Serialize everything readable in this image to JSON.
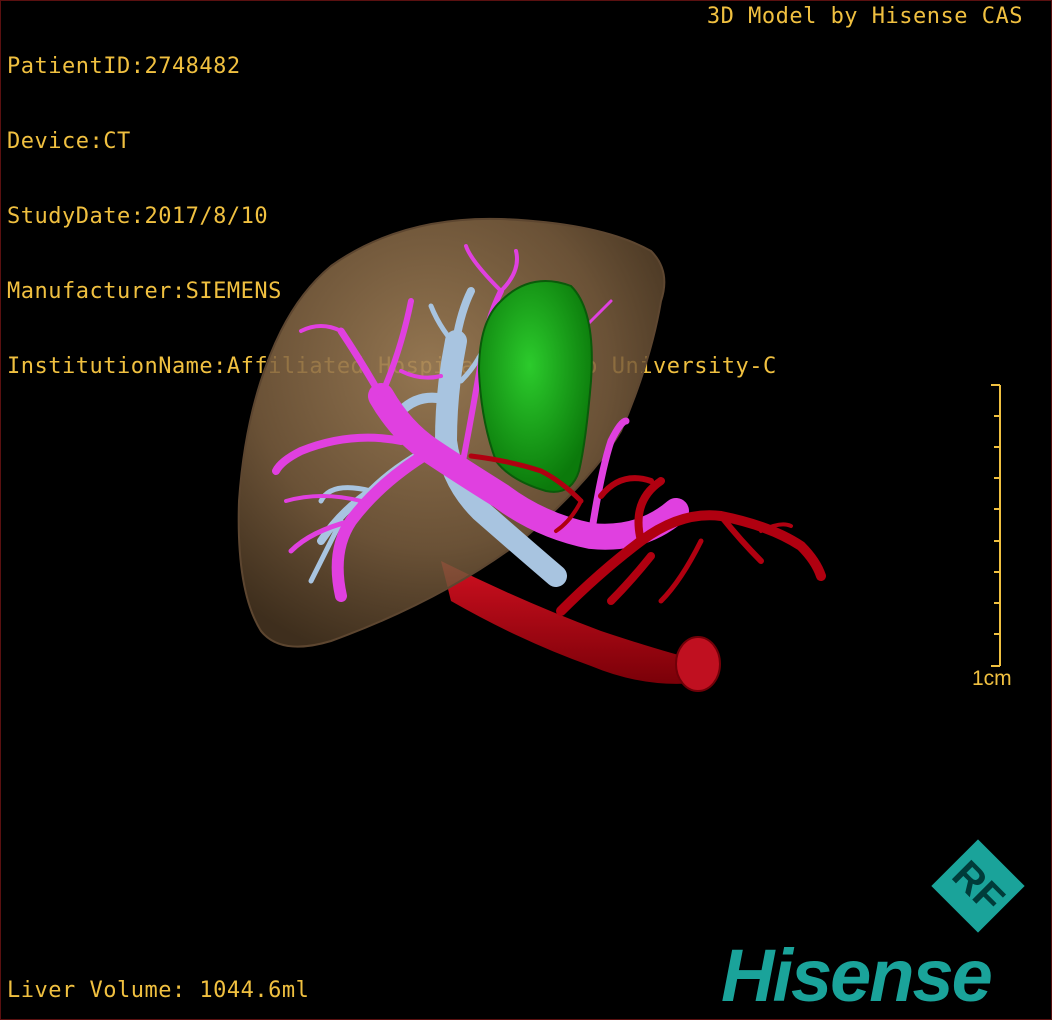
{
  "patient_info": {
    "patient_id": "PatientID:2748482",
    "device": "Device:CT",
    "study_date": "StudyDate:2017/8/10",
    "manufacturer": "Manufacturer:SIEMENS",
    "institution": "InstitutionName:Affiliated Hospital Qingdao University-C"
  },
  "model_credit": "3D Model by Hisense CAS",
  "liver_volume": "Liver Volume: 1044.6ml",
  "scale_bar": {
    "label": "1cm"
  },
  "branding": {
    "badge_text": "RF",
    "wordmark": "Hisense"
  },
  "colors": {
    "overlay_text": "#f0c040",
    "liver": "#8a6a44",
    "gallbladder": "#15a315",
    "portal_vein": "#e040e0",
    "hepatic_vein": "#a8c4e0",
    "artery": "#b00010",
    "brand": "#1aa39a"
  }
}
